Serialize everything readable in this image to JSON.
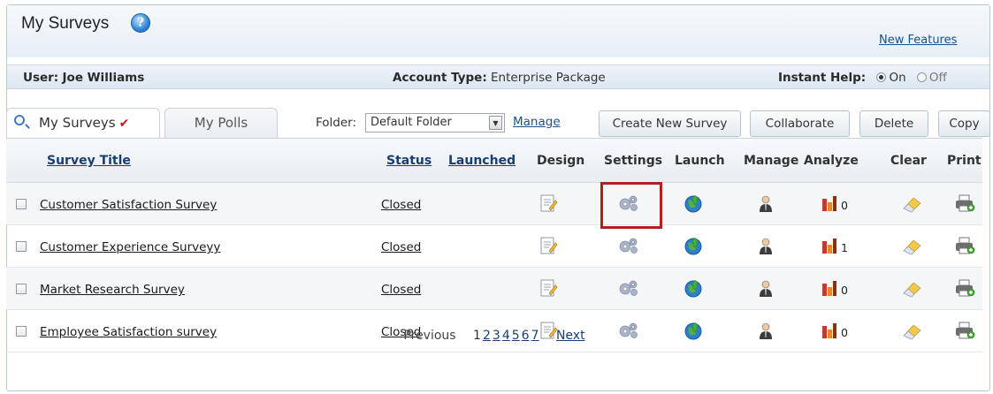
{
  "header": {
    "title": "My Surveys",
    "help_icon": "help-icon",
    "new_features": "New Features"
  },
  "info": {
    "user_label": "User:",
    "user_name": "Joe Williams",
    "account_label": "Account Type:",
    "account_value": "Enterprise Package",
    "help_label": "Instant Help:",
    "on": "On",
    "off": "Off",
    "help_selected": "On"
  },
  "tabs": {
    "surveys": "My Surveys",
    "polls": "My Polls"
  },
  "toolbar": {
    "folder_label": "Folder:",
    "folder_value": "Default Folder",
    "manage": "Manage",
    "create": "Create New Survey",
    "collaborate": "Collaborate",
    "delete": "Delete",
    "copy": "Copy"
  },
  "columns": {
    "title": "Survey Title",
    "status": "Status",
    "launched": "Launched",
    "design": "Design",
    "settings": "Settings",
    "launch": "Launch",
    "manage": "Manage",
    "analyze": "Analyze",
    "clear": "Clear",
    "print": "Print"
  },
  "rows": [
    {
      "title": "Customer Satisfaction Survey",
      "status": "Closed",
      "count": "0"
    },
    {
      "title": "Customer Experience Surveyy",
      "status": "Closed",
      "count": "1"
    },
    {
      "title": "Market Research Survey",
      "status": "Closed",
      "count": "0"
    },
    {
      "title": "Employee Satisfaction survey",
      "status": "Closed",
      "count": "0"
    }
  ],
  "pager": {
    "previous": "Previous",
    "pages": [
      "1",
      "2",
      "3",
      "4",
      "5",
      "6",
      "7"
    ],
    "next": "Next"
  },
  "colors": {
    "highlight": "#b11f1f",
    "link": "#1a4f91"
  }
}
